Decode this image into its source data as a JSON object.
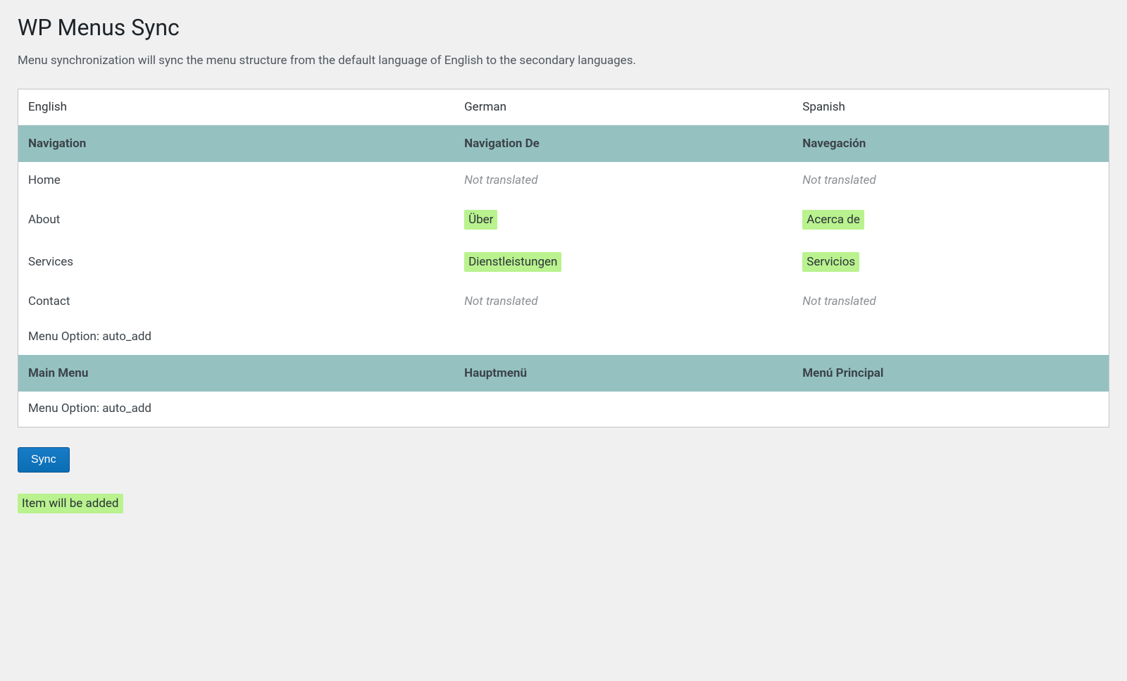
{
  "page": {
    "title": "WP Menus Sync",
    "description": "Menu synchronization will sync the menu structure from the default language of English to the secondary languages."
  },
  "table": {
    "headers": {
      "english": "English",
      "german": "German",
      "spanish": "Spanish"
    },
    "groups": [
      {
        "names": {
          "english": "Navigation",
          "german": "Navigation De",
          "spanish": "Navegación"
        },
        "items": [
          {
            "english": "Home",
            "german": {
              "text": "Not translated",
              "status": "not-translated"
            },
            "spanish": {
              "text": "Not translated",
              "status": "not-translated"
            }
          },
          {
            "english": "About",
            "german": {
              "text": "Über",
              "status": "added"
            },
            "spanish": {
              "text": "Acerca de",
              "status": "added"
            }
          },
          {
            "english": "Services",
            "german": {
              "text": "Dienstleistungen",
              "status": "added"
            },
            "spanish": {
              "text": "Servicios",
              "status": "added"
            }
          },
          {
            "english": "Contact",
            "german": {
              "text": "Not translated",
              "status": "not-translated"
            },
            "spanish": {
              "text": "Not translated",
              "status": "not-translated"
            }
          }
        ],
        "option": "Menu Option: auto_add"
      },
      {
        "names": {
          "english": "Main Menu",
          "german": "Hauptmenü",
          "spanish": "Menú Principal"
        },
        "items": [],
        "option": "Menu Option: auto_add"
      }
    ]
  },
  "actions": {
    "sync_label": "Sync"
  },
  "legend": {
    "added": "Item will be added"
  }
}
